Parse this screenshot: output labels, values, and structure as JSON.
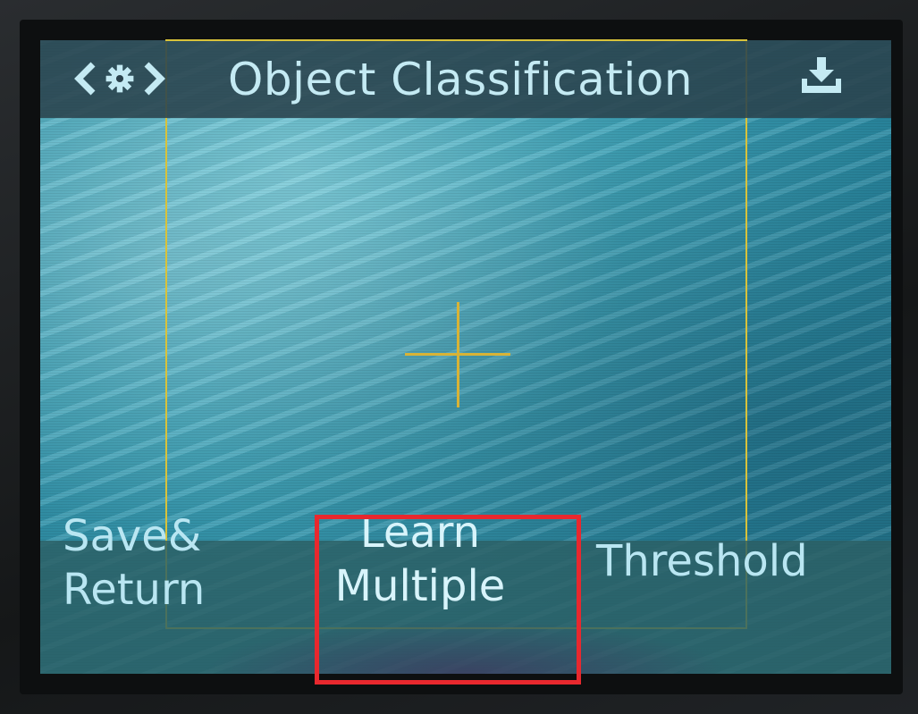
{
  "header": {
    "title": "Object Classification",
    "icons": [
      "chevron-left-icon",
      "gear-icon",
      "chevron-right-icon",
      "download-icon"
    ]
  },
  "bottom_bar": {
    "save_return": {
      "line1": "Save&",
      "line2": "Return"
    },
    "learn_multiple": {
      "line1": "Learn",
      "line2": "Multiple"
    },
    "threshold": "Threshold"
  },
  "colors": {
    "header_text": "#c4eaf3",
    "button_text": "#b9e6f2",
    "frame_yellow": "#d8c23a",
    "highlight_red": "#e8282e"
  }
}
